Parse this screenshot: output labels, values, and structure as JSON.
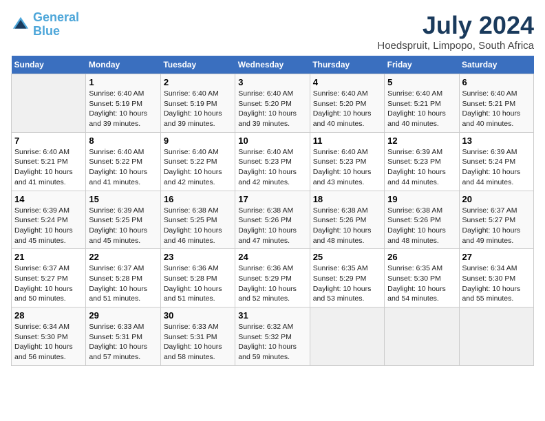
{
  "header": {
    "logo_line1": "General",
    "logo_line2": "Blue",
    "title": "July 2024",
    "subtitle": "Hoedspruit, Limpopo, South Africa"
  },
  "weekdays": [
    "Sunday",
    "Monday",
    "Tuesday",
    "Wednesday",
    "Thursday",
    "Friday",
    "Saturday"
  ],
  "weeks": [
    [
      {
        "day": "",
        "text": ""
      },
      {
        "day": "1",
        "text": "Sunrise: 6:40 AM\nSunset: 5:19 PM\nDaylight: 10 hours\nand 39 minutes."
      },
      {
        "day": "2",
        "text": "Sunrise: 6:40 AM\nSunset: 5:19 PM\nDaylight: 10 hours\nand 39 minutes."
      },
      {
        "day": "3",
        "text": "Sunrise: 6:40 AM\nSunset: 5:20 PM\nDaylight: 10 hours\nand 39 minutes."
      },
      {
        "day": "4",
        "text": "Sunrise: 6:40 AM\nSunset: 5:20 PM\nDaylight: 10 hours\nand 40 minutes."
      },
      {
        "day": "5",
        "text": "Sunrise: 6:40 AM\nSunset: 5:21 PM\nDaylight: 10 hours\nand 40 minutes."
      },
      {
        "day": "6",
        "text": "Sunrise: 6:40 AM\nSunset: 5:21 PM\nDaylight: 10 hours\nand 40 minutes."
      }
    ],
    [
      {
        "day": "7",
        "text": "Sunrise: 6:40 AM\nSunset: 5:21 PM\nDaylight: 10 hours\nand 41 minutes."
      },
      {
        "day": "8",
        "text": "Sunrise: 6:40 AM\nSunset: 5:22 PM\nDaylight: 10 hours\nand 41 minutes."
      },
      {
        "day": "9",
        "text": "Sunrise: 6:40 AM\nSunset: 5:22 PM\nDaylight: 10 hours\nand 42 minutes."
      },
      {
        "day": "10",
        "text": "Sunrise: 6:40 AM\nSunset: 5:23 PM\nDaylight: 10 hours\nand 42 minutes."
      },
      {
        "day": "11",
        "text": "Sunrise: 6:40 AM\nSunset: 5:23 PM\nDaylight: 10 hours\nand 43 minutes."
      },
      {
        "day": "12",
        "text": "Sunrise: 6:39 AM\nSunset: 5:23 PM\nDaylight: 10 hours\nand 44 minutes."
      },
      {
        "day": "13",
        "text": "Sunrise: 6:39 AM\nSunset: 5:24 PM\nDaylight: 10 hours\nand 44 minutes."
      }
    ],
    [
      {
        "day": "14",
        "text": "Sunrise: 6:39 AM\nSunset: 5:24 PM\nDaylight: 10 hours\nand 45 minutes."
      },
      {
        "day": "15",
        "text": "Sunrise: 6:39 AM\nSunset: 5:25 PM\nDaylight: 10 hours\nand 45 minutes."
      },
      {
        "day": "16",
        "text": "Sunrise: 6:38 AM\nSunset: 5:25 PM\nDaylight: 10 hours\nand 46 minutes."
      },
      {
        "day": "17",
        "text": "Sunrise: 6:38 AM\nSunset: 5:26 PM\nDaylight: 10 hours\nand 47 minutes."
      },
      {
        "day": "18",
        "text": "Sunrise: 6:38 AM\nSunset: 5:26 PM\nDaylight: 10 hours\nand 48 minutes."
      },
      {
        "day": "19",
        "text": "Sunrise: 6:38 AM\nSunset: 5:26 PM\nDaylight: 10 hours\nand 48 minutes."
      },
      {
        "day": "20",
        "text": "Sunrise: 6:37 AM\nSunset: 5:27 PM\nDaylight: 10 hours\nand 49 minutes."
      }
    ],
    [
      {
        "day": "21",
        "text": "Sunrise: 6:37 AM\nSunset: 5:27 PM\nDaylight: 10 hours\nand 50 minutes."
      },
      {
        "day": "22",
        "text": "Sunrise: 6:37 AM\nSunset: 5:28 PM\nDaylight: 10 hours\nand 51 minutes."
      },
      {
        "day": "23",
        "text": "Sunrise: 6:36 AM\nSunset: 5:28 PM\nDaylight: 10 hours\nand 51 minutes."
      },
      {
        "day": "24",
        "text": "Sunrise: 6:36 AM\nSunset: 5:29 PM\nDaylight: 10 hours\nand 52 minutes."
      },
      {
        "day": "25",
        "text": "Sunrise: 6:35 AM\nSunset: 5:29 PM\nDaylight: 10 hours\nand 53 minutes."
      },
      {
        "day": "26",
        "text": "Sunrise: 6:35 AM\nSunset: 5:30 PM\nDaylight: 10 hours\nand 54 minutes."
      },
      {
        "day": "27",
        "text": "Sunrise: 6:34 AM\nSunset: 5:30 PM\nDaylight: 10 hours\nand 55 minutes."
      }
    ],
    [
      {
        "day": "28",
        "text": "Sunrise: 6:34 AM\nSunset: 5:30 PM\nDaylight: 10 hours\nand 56 minutes."
      },
      {
        "day": "29",
        "text": "Sunrise: 6:33 AM\nSunset: 5:31 PM\nDaylight: 10 hours\nand 57 minutes."
      },
      {
        "day": "30",
        "text": "Sunrise: 6:33 AM\nSunset: 5:31 PM\nDaylight: 10 hours\nand 58 minutes."
      },
      {
        "day": "31",
        "text": "Sunrise: 6:32 AM\nSunset: 5:32 PM\nDaylight: 10 hours\nand 59 minutes."
      },
      {
        "day": "",
        "text": ""
      },
      {
        "day": "",
        "text": ""
      },
      {
        "day": "",
        "text": ""
      }
    ]
  ]
}
